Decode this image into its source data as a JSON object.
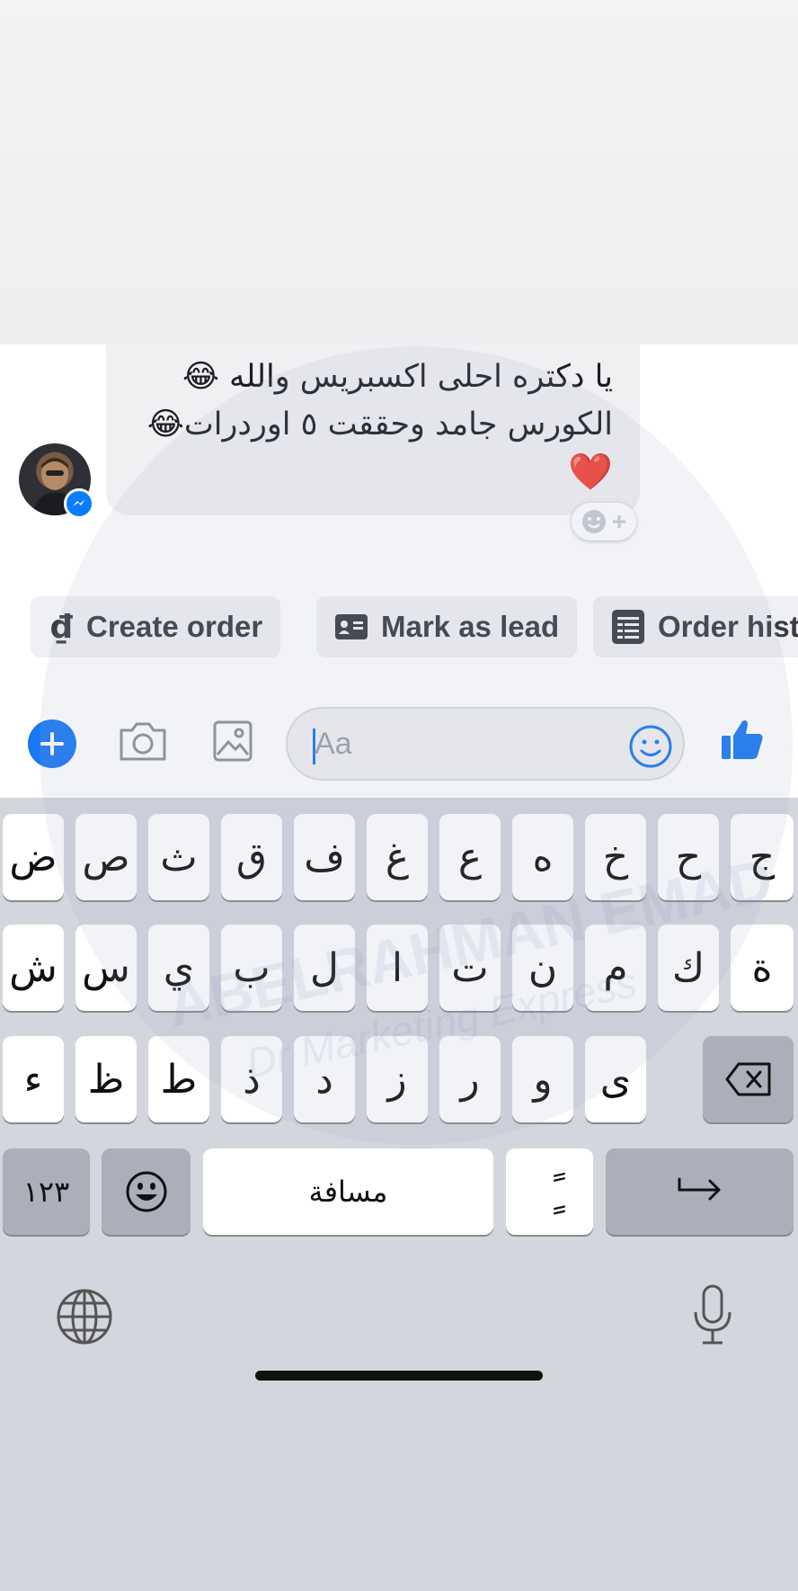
{
  "message": {
    "lines": [
      "يا دكتره احلى اكسبريس والله 😂",
      "الكورس جامد وحققت ٥ اوردرات😂",
      "❤️"
    ]
  },
  "quick_actions": [
    {
      "label": "Create order",
      "icon": "dong-currency-icon"
    },
    {
      "label": "Mark as lead",
      "icon": "contact-card-icon"
    },
    {
      "label": "Order hist",
      "icon": "list-document-icon"
    }
  ],
  "composer": {
    "placeholder": "Aa"
  },
  "keyboard": {
    "row1": [
      "ض",
      "ص",
      "ث",
      "ق",
      "ف",
      "غ",
      "ع",
      "ه",
      "خ",
      "ح",
      "ج"
    ],
    "row2": [
      "ش",
      "س",
      "ي",
      "ب",
      "ل",
      "ا",
      "ت",
      "ن",
      "م",
      "ك",
      "ة"
    ],
    "row3": [
      "ء",
      "ظ",
      "ط",
      "ذ",
      "د",
      "ز",
      "ر",
      "و",
      "ى"
    ],
    "numbers_label": "١٢٣",
    "space_label": "مسافة",
    "diacritic_label": "ًٍ"
  },
  "watermark": {
    "title": "ABELRAHMAN EMAD",
    "subtitle": "Dr Marketing Express"
  },
  "colors": {
    "accent": "#1877f2",
    "keyboard_bg": "#d3d6dd",
    "key_dark": "#abafba"
  }
}
